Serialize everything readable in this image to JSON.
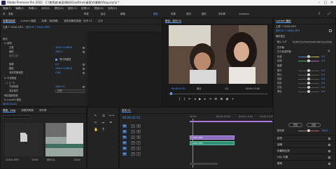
{
  "titlebar": {
    "title": "Adobe Premiere Pro 2022 - C:\\使用者\\桌面\\情侶\\OneDrive\\桌面\\作業稿\\Vlog.prproj *"
  },
  "menu": [
    "檔案(F)",
    "編輯(E)",
    "剪輯(C)",
    "序列(S)",
    "標記(M)",
    "圖形(G)",
    "檢視(V)",
    "視窗(W)",
    "說明(H)"
  ],
  "workspaces": [
    {
      "label": "首頁",
      "active": false
    },
    {
      "label": "學習",
      "active": false
    },
    {
      "label": "組合",
      "active": false
    },
    {
      "label": "編輯",
      "active": false
    },
    {
      "label": "顏色",
      "active": true
    },
    {
      "label": "效果",
      "active": false
    },
    {
      "label": "音訊",
      "active": false
    },
    {
      "label": "圖形",
      "active": false
    },
    {
      "label": "資料庫",
      "active": false
    },
    {
      "label": "Captions",
      "active": false
    }
  ],
  "effect_controls": {
    "tabs": [
      "效果控制項",
      "Lumetri 範圍",
      "來源：(無剪輯)",
      "音訊剪輯混音器：序列 01",
      "文字"
    ],
    "source": "主要 * C0301.MP4",
    "sequence": "序列 01 * C0301.MP4",
    "section_video": "視訊",
    "fx_motion": "fx 動態",
    "position_label": "位置",
    "position_value": "1920.0   1080.0",
    "scale_label": "縮放",
    "scale_value": "100.0",
    "scale_width_label": "縮放寬度",
    "uniform_label": "等比例縮放",
    "rotation_label": "旋轉",
    "rotation_value": "0.0",
    "anchor_label": "錨點",
    "anchor_value": "1920.0   1080.0",
    "flicker_label": "消除閃爍濾鏡",
    "flicker_value": "0.00",
    "opacity_label": "fx 不透明度",
    "opacity_value_label": "不透明度",
    "opacity_value": "100.0 %",
    "blend_label": "混合模式",
    "blend_value": "正常",
    "timeremap_label": "時間重新對應",
    "lumetri_label": "fx Lumetri 顏色",
    "timecode": "00:00:02:01"
  },
  "program": {
    "tab": "節目：序列 01",
    "timecode": "00:00:02:01",
    "fit": "適合",
    "quality": "1/2",
    "duration": "00:00:13:00"
  },
  "project": {
    "tabs": [
      "專案：Vlog",
      "媒體瀏覽器",
      "資料庫"
    ],
    "active_tab": "專案：Vlog",
    "search_placeholder": "",
    "clips": [
      {
        "name": "C0301.MP4",
        "duration": "13:00"
      },
      {
        "name": "序列 01",
        "duration": "13:00"
      }
    ]
  },
  "timeline": {
    "tab": "序列 01",
    "timecode": "00:00:02:01",
    "tracks": [
      {
        "name": "V3"
      },
      {
        "name": "V2"
      },
      {
        "name": "V1"
      },
      {
        "name": "A1"
      },
      {
        "name": "A2"
      },
      {
        "name": "A3"
      }
    ],
    "clip_v1": "C0301.MP4",
    "clip_a1": "C0301.MP4",
    "ruler": [
      "00:00",
      "00:00:05:00",
      "00:00:10:00",
      "00:00:15:00"
    ]
  },
  "lumetri": {
    "tab": "Lumetri 顏色",
    "source": "主要 * C0301.MP4",
    "sequence": "序列 01 * C0301.MP4",
    "basic": "基本校正",
    "input_lut_label": "輸入 LUT",
    "input_lut_value": "Fujifilm Fuji F125 Kodak 2393 (by Adobe)",
    "wb_label": "白平衡",
    "wb_selector": "白平衡選擇器",
    "temp_label": "色溫",
    "temp_value": "0.0",
    "tint_label": "色調",
    "tint_value": "0.0",
    "tone_label": "色調",
    "exposure_label": "曝光",
    "exposure_value": "0.0",
    "contrast_label": "對比",
    "contrast_value": "0.0",
    "highlights_label": "亮部",
    "highlights_value": "0.0",
    "shadows_label": "陰影",
    "shadows_value": "0.0",
    "whites_label": "白色",
    "whites_value": "0.0",
    "blacks_label": "黑色",
    "blacks_value": "0.0",
    "reset_label": "重設",
    "auto_label": "自動",
    "saturation_label": "飽和度",
    "saturation_value": "100.0",
    "sections": [
      "創意",
      "曲線",
      "色輪與比對",
      "HSL 次要",
      "暈映"
    ]
  }
}
